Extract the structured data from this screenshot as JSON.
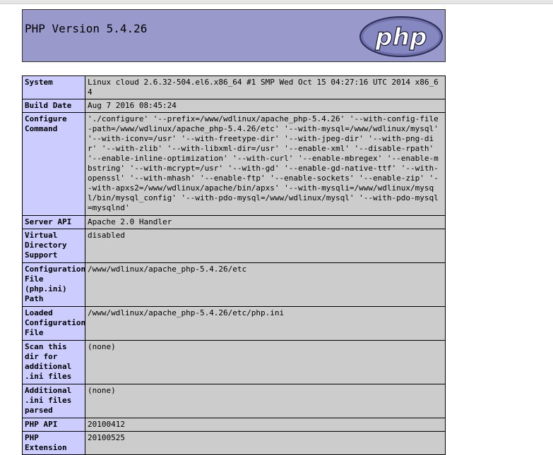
{
  "header": {
    "title": "PHP Version 5.4.26",
    "logo_text": "php"
  },
  "rows": [
    {
      "label": "System",
      "value": "Linux cloud 2.6.32-504.el6.x86_64 #1 SMP Wed Oct 15 04:27:16 UTC 2014 x86_64"
    },
    {
      "label": "Build Date",
      "value": "Aug 7 2016 08:45:24"
    },
    {
      "label": "Configure Command",
      "value": "'./configure' '--prefix=/www/wdlinux/apache_php-5.4.26' '--with-config-file-path=/www/wdlinux/apache_php-5.4.26/etc' '--with-mysql=/www/wdlinux/mysql' '--with-iconv=/usr' '--with-freetype-dir' '--with-jpeg-dir' '--with-png-dir' '--with-zlib' '--with-libxml-dir=/usr' '--enable-xml' '--disable-rpath' '--enable-inline-optimization' '--with-curl' '--enable-mbregex' '--enable-mbstring' '--with-mcrypt=/usr' '--with-gd' '--enable-gd-native-ttf' '--with-openssl' '--with-mhash' '--enable-ftp' '--enable-sockets' '--enable-zip' '--with-apxs2=/www/wdlinux/apache/bin/apxs' '--with-mysqli=/www/wdlinux/mysql/bin/mysql_config' '--with-pdo-mysql=/www/wdlinux/mysql' '--with-pdo-mysql=mysqlnd'"
    },
    {
      "label": "Server API",
      "value": "Apache 2.0 Handler"
    },
    {
      "label": "Virtual Directory Support",
      "value": "disabled"
    },
    {
      "label": "Configuration File (php.ini) Path",
      "value": "/www/wdlinux/apache_php-5.4.26/etc"
    },
    {
      "label": "Loaded Configuration File",
      "value": "/www/wdlinux/apache_php-5.4.26/etc/php.ini"
    },
    {
      "label": "Scan this dir for additional .ini files",
      "value": "(none)"
    },
    {
      "label": "Additional .ini files parsed",
      "value": "(none)"
    },
    {
      "label": "PHP API",
      "value": "20100412"
    },
    {
      "label": "PHP Extension",
      "value": "20100525"
    }
  ]
}
